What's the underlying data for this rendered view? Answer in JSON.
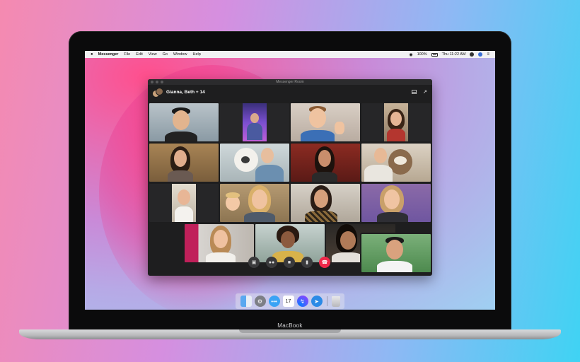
{
  "menubar": {
    "app_name": "Messenger",
    "items": [
      "File",
      "Edit",
      "View",
      "Go",
      "Window",
      "Help"
    ],
    "battery": "100%",
    "clock": "Thu 11:22 AM"
  },
  "window": {
    "title": "Messenger Room",
    "participants": "Gianna, Beth + 14"
  },
  "controls": {
    "share_icon": "screen-share-icon",
    "people_icon": "participants-icon",
    "video_icon": "video-camera-icon",
    "mic_icon": "microphone-icon",
    "end_icon": "end-call-icon"
  },
  "dock": {
    "apps": [
      "finder-icon",
      "settings-icon",
      "messages-icon",
      "calendar-icon",
      "messenger-icon",
      "safari-icon",
      "trash-icon"
    ],
    "calendar_day": "17"
  },
  "device": {
    "brand": "MacBook"
  },
  "colors": {
    "end_call": "#f02849",
    "messenger_blue": "#0a7cff"
  }
}
